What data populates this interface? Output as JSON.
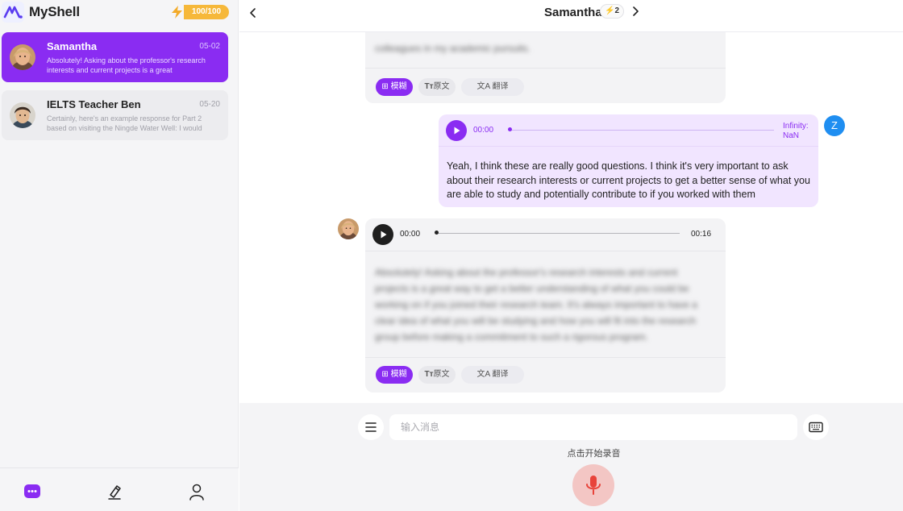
{
  "brand": {
    "name": "MyShell",
    "energy": "100/100"
  },
  "sidebar": {
    "chats": [
      {
        "name": "Samantha",
        "date": "05-02",
        "preview": "Absolutely! Asking about the professor's research interests and current projects is a great"
      },
      {
        "name": "IELTS Teacher Ben",
        "date": "05-20",
        "preview": "Certainly, here's an example response for Part 2 based on visiting the Ningde Water Well: I would"
      }
    ]
  },
  "header": {
    "title": "Samantha",
    "badge_count": "2"
  },
  "messages": {
    "bot_top": {
      "text": "colleagues in my academic pursuits.",
      "chips": {
        "blur": "模糊",
        "original": "原文",
        "translate": "翻译"
      }
    },
    "user": {
      "audio_time": "00:00",
      "audio_duration_line1": "Infinity:",
      "audio_duration_line2": "NaN",
      "text": "Yeah, I think these are really good questions. I think it's very important to ask about their research interests or current projects to get a better sense of what you are able to study and potentially contribute to if you worked with them",
      "avatar_letter": "Z"
    },
    "bot": {
      "audio_time": "00:00",
      "audio_duration": "00:16",
      "text": "Absolutely! Asking about the professor's research interests and current projects is a great way to get a better understanding of what you could be working on if you joined their research team. It's always important to have a clear idea of what you will be studying and how you will fit into the research group before making a commitment to such a rigorous program.",
      "chips": {
        "blur": "模糊",
        "original": "原文",
        "translate": "翻译"
      }
    }
  },
  "input": {
    "placeholder": "输入消息",
    "record_hint": "点击开始录音"
  },
  "colors": {
    "accent": "#8a2cf2",
    "energy": "#f6b83a",
    "user_avatar": "#1f8ef1",
    "mic": "#e8433a"
  }
}
